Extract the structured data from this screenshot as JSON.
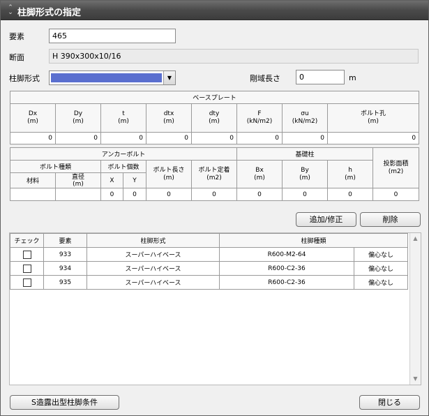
{
  "window": {
    "title": "柱脚形式の指定"
  },
  "form": {
    "element_label": "要素",
    "element_value": "465",
    "section_label": "断面",
    "section_value": "H 390x300x10/16",
    "base_type_label": "柱脚形式",
    "rigid_zone_label": "剛域長さ",
    "rigid_zone_value": "0",
    "rigid_zone_unit": "m"
  },
  "base_plate": {
    "group": "ベースプレート",
    "headers": [
      {
        "name": "Dx",
        "unit": "(m)"
      },
      {
        "name": "Dy",
        "unit": "(m)"
      },
      {
        "name": "t",
        "unit": "(m)"
      },
      {
        "name": "dtx",
        "unit": "(m)"
      },
      {
        "name": "dty",
        "unit": "(m)"
      },
      {
        "name": "F",
        "unit": "(kN/m2)"
      },
      {
        "name": "σu",
        "unit": "(kN/m2)"
      },
      {
        "name": "ボルト孔",
        "unit": "(m)"
      }
    ],
    "values": [
      "0",
      "0",
      "0",
      "0",
      "0",
      "0",
      "0",
      "0"
    ]
  },
  "anchor": {
    "group": "アンカーボルト",
    "bolt_type": "ボルト種類",
    "bolt_count": "ボルト個数",
    "material": "材料",
    "diameter": "直径\n(m)",
    "x": "X",
    "y": "Y",
    "bolt_length": "ボルト長さ\n(m)",
    "bolt_fix": "ボルト定着\n(m2)",
    "foundation_group": "基礎柱",
    "bx": "Bx\n(m)",
    "by": "By\n(m)",
    "h": "h\n(m)",
    "projected_area": "投影面積\n(m2)",
    "values": {
      "x": "0",
      "y": "0",
      "bolt_length": "0",
      "bolt_fix": "0",
      "bx": "0",
      "by": "0",
      "h": "0",
      "area": "0"
    }
  },
  "buttons": {
    "add_edit": "追加/修正",
    "delete": "削除",
    "s_exposed": "S造露出型柱脚条件",
    "close": "閉じる"
  },
  "list": {
    "headers": {
      "check": "チェック",
      "element": "要素",
      "base_type": "柱脚形式",
      "base_kind": "柱脚種類"
    },
    "rows": [
      {
        "element": "933",
        "base_type": "スーパーハイベース",
        "base_kind": "R600-M2-64",
        "note": "偏心なし"
      },
      {
        "element": "934",
        "base_type": "スーパーハイベース",
        "base_kind": "R600-C2-36",
        "note": "偏心なし"
      },
      {
        "element": "935",
        "base_type": "スーパーハイベース",
        "base_kind": "R600-C2-36",
        "note": "偏心なし"
      }
    ]
  },
  "colors": {
    "combo_fill": "#5a6fcf",
    "titlebar": "#4a4a4a"
  },
  "icons": {
    "title": "collapse-chevron-icon",
    "combo": "chevron-down-icon"
  }
}
